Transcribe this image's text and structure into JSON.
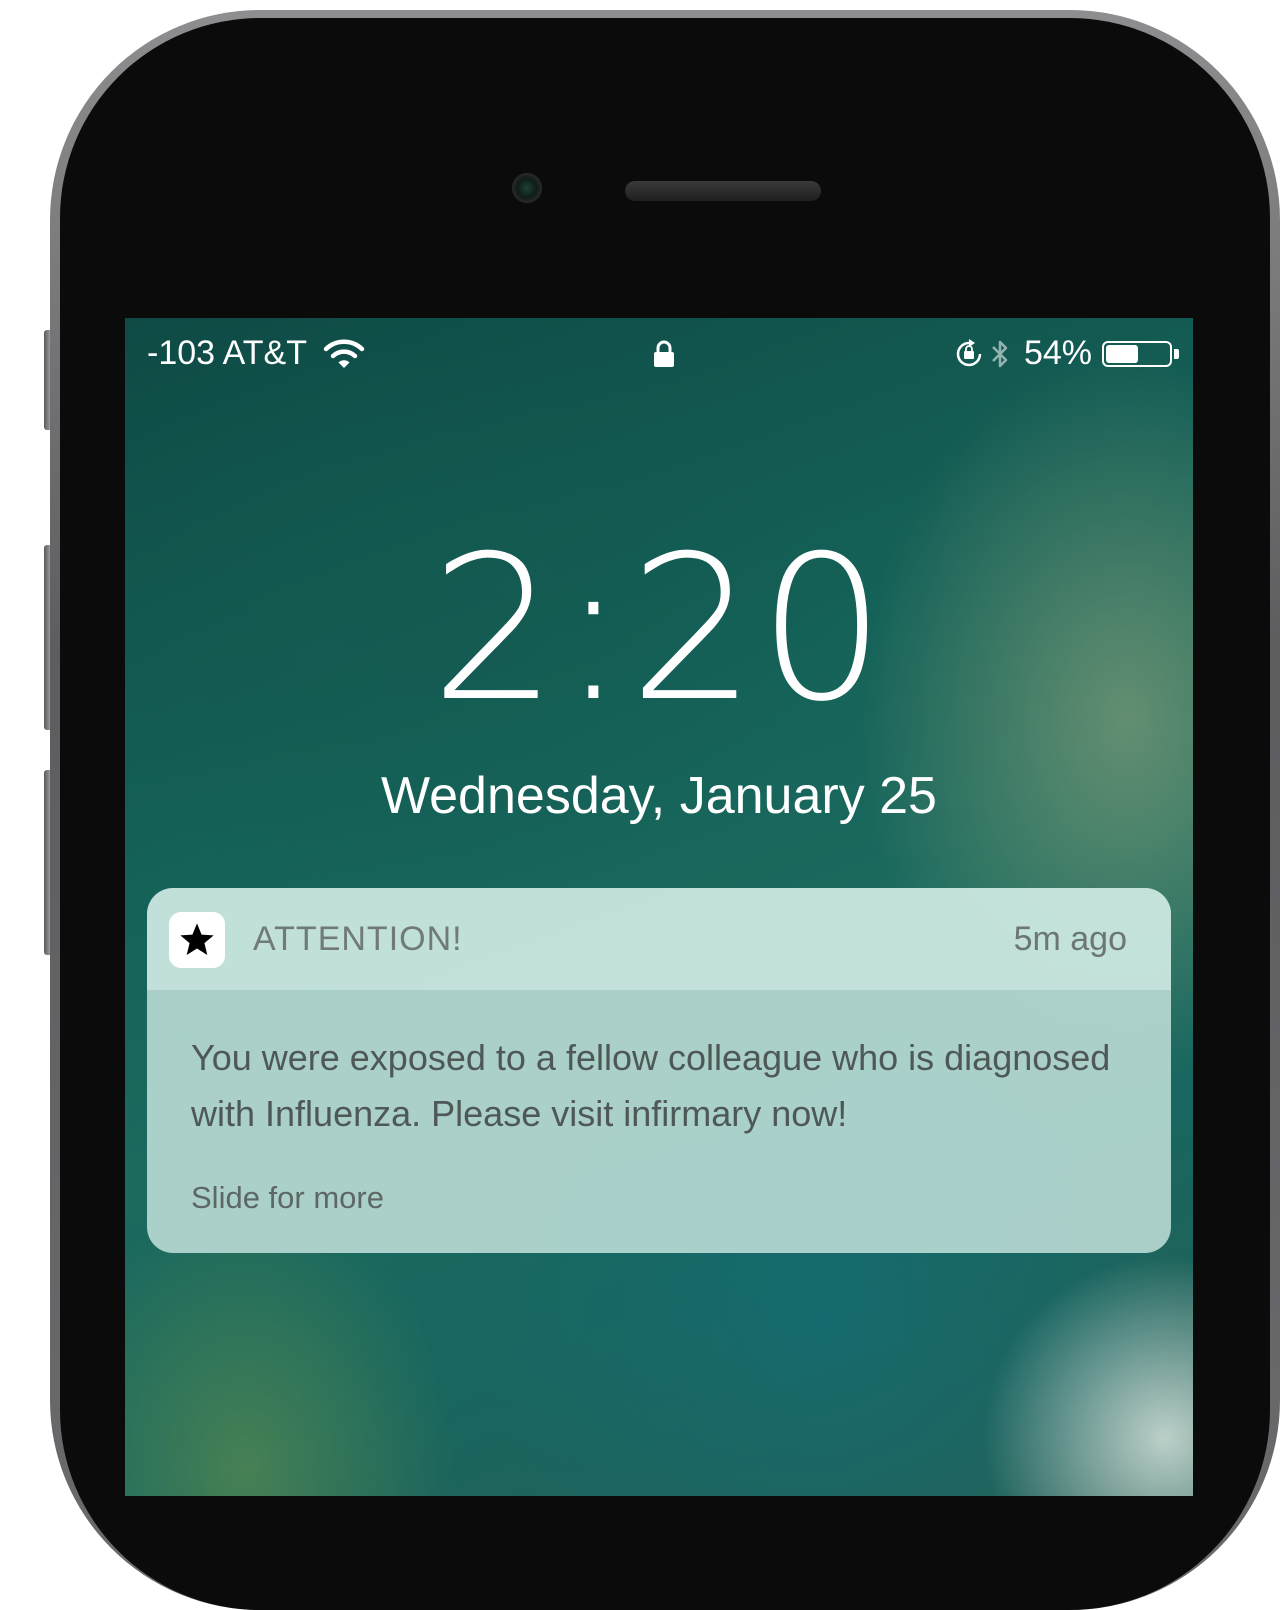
{
  "status_bar": {
    "carrier": "-103 AT&T",
    "battery_percent": "54%",
    "battery_level": 0.54
  },
  "lock_screen": {
    "time": "2:20",
    "date": "Wednesday, January 25"
  },
  "notification": {
    "app_name": "ATTENTION!",
    "time_ago": "5m ago",
    "message": "You were exposed to a fellow colleague who is diagnosed with Influenza. Please visit infirmary now!",
    "hint": "Slide for more",
    "icon": "star-icon"
  },
  "colors": {
    "screen_base": "#146158",
    "notification_bg": "#c6e4de",
    "text_white": "#ffffff"
  }
}
